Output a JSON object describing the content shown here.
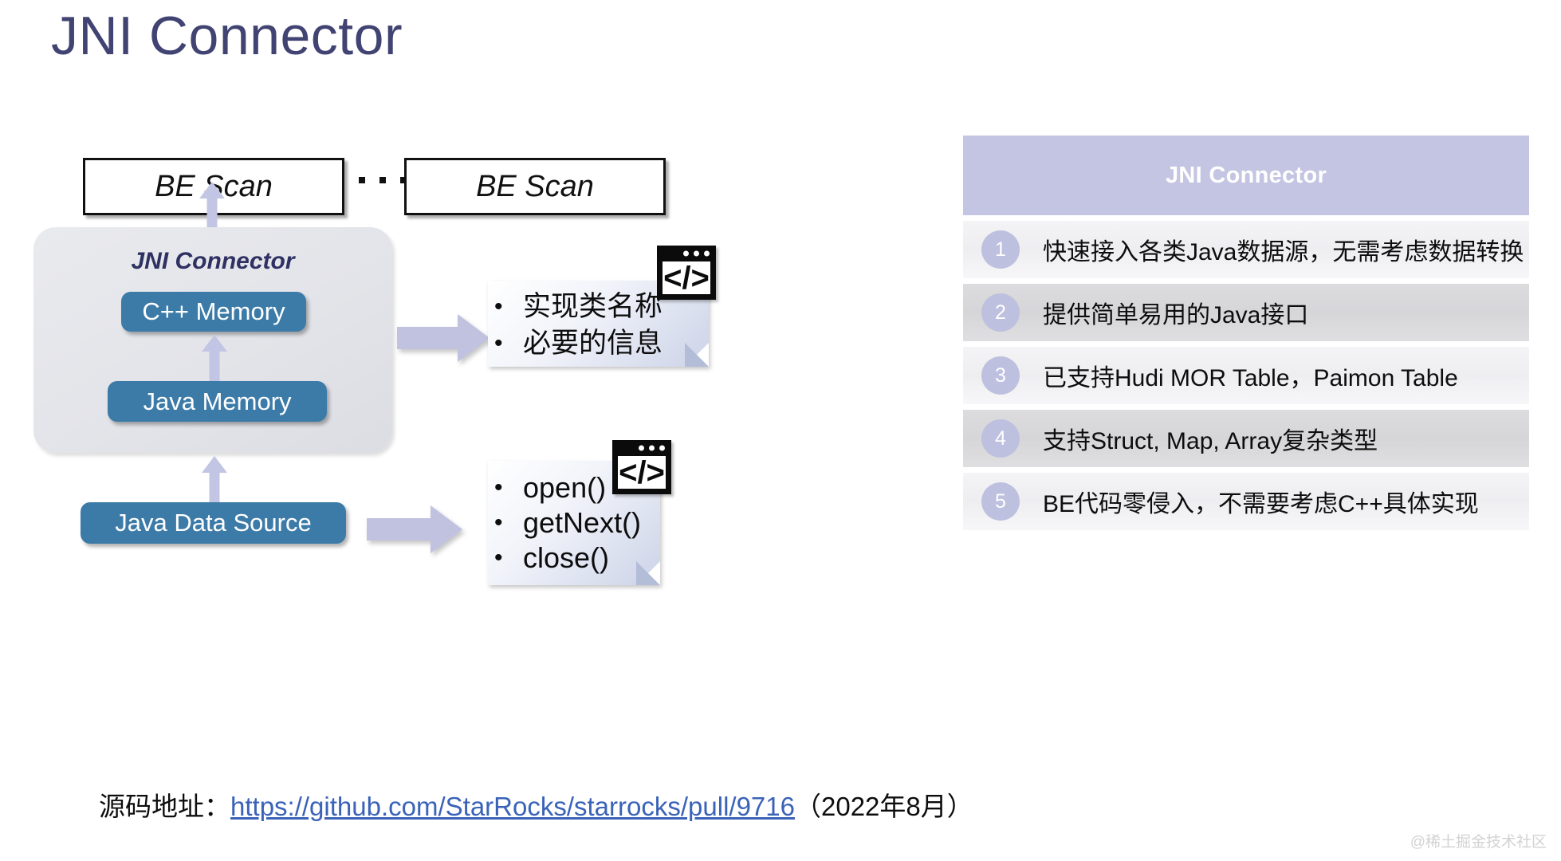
{
  "slide": {
    "title": "JNI Connector"
  },
  "diagram": {
    "be_scan_left": "BE Scan",
    "be_scan_right": "BE Scan",
    "ellipsis": "...",
    "container_label": "JNI Connector",
    "boxes": {
      "cpp_memory": "C++ Memory",
      "java_memory": "Java Memory",
      "java_data_source": "Java Data Source"
    },
    "note_1": {
      "items": [
        "实现类名称",
        "必要的信息"
      ]
    },
    "note_2": {
      "items": [
        "open()",
        "getNext()",
        "close()"
      ]
    },
    "code_icon_glyph": "</>",
    "colors": {
      "box_blue": "#3c7ba8",
      "arrow_lavender": "#c3c5e4",
      "container_gray": "#e5e6eb",
      "title_navy": "#414372"
    }
  },
  "panel": {
    "header": "JNI Connector",
    "rows": [
      {
        "num": "1",
        "text": "快速接入各类Java数据源，无需考虑数据转换"
      },
      {
        "num": "2",
        "text": "提供简单易用的Java接口"
      },
      {
        "num": "3",
        "text": "已支持Hudi MOR Table，Paimon Table"
      },
      {
        "num": "4",
        "text": "支持Struct, Map, Array复杂类型"
      },
      {
        "num": "5",
        "text": "BE代码零侵入，不需要考虑C++具体实现"
      }
    ],
    "colors": {
      "header_bg": "#c3c5e2",
      "badge_bg": "#bdc0de"
    }
  },
  "footer": {
    "label": "源码地址：",
    "link_text": "https://github.com/StarRocks/starrocks/pull/9716",
    "suffix": "（2022年8月）"
  },
  "watermark": "@稀土掘金技术社区"
}
